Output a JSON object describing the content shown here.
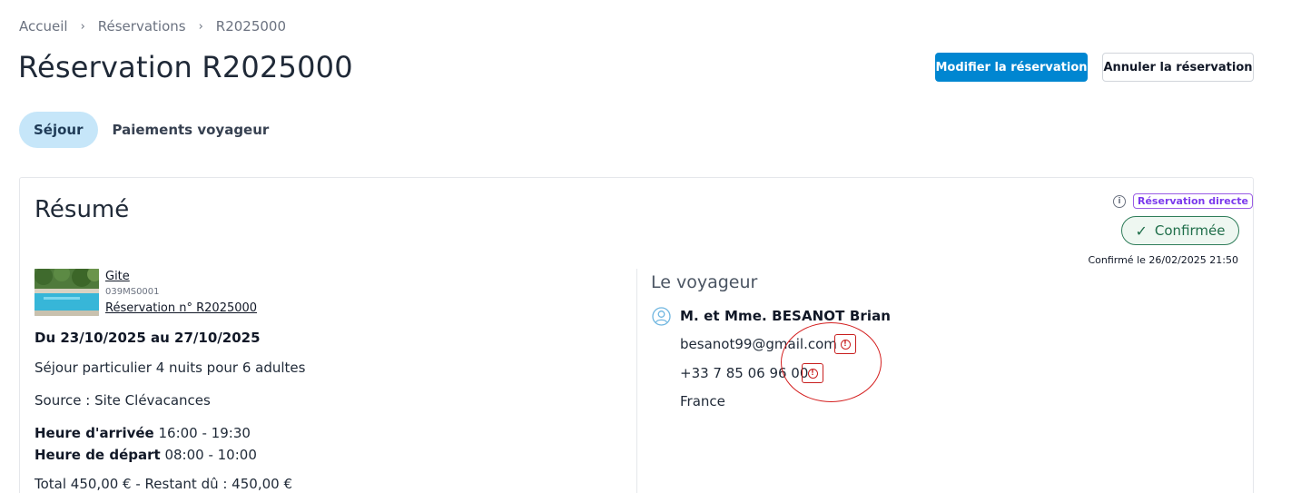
{
  "breadcrumb": {
    "home": "Accueil",
    "section": "Réservations",
    "current": "R2025000"
  },
  "page": {
    "title": "Réservation R2025000"
  },
  "actions": {
    "modify": "Modifier la réservation",
    "cancel": "Annuler la réservation"
  },
  "tabs": [
    {
      "label": "Séjour",
      "active": true
    },
    {
      "label": "Paiements voyageur",
      "active": false
    }
  ],
  "summary": {
    "title": "Résumé",
    "channel_badge": "Réservation directe",
    "status": "Confirmée",
    "status_icon": "check-icon",
    "confirmed_at": "Confirmé le 26/02/2025 21:50",
    "property": {
      "name": "Gite",
      "code": "039MS0001",
      "reservation_link": "Réservation n° R2025000"
    },
    "dates": "Du 23/10/2025 au 27/10/2025",
    "stay_description": "Séjour particulier 4 nuits pour 6 adultes",
    "source": "Source : Site Clévacances",
    "arrival_label": "Heure d'arrivée",
    "arrival_value": "16:00 - 19:30",
    "departure_label": "Heure de départ",
    "departure_value": "08:00 - 10:00",
    "total": "Total 450,00 €  -  Restant dû : 450,00 €"
  },
  "guest": {
    "section_title": "Le voyageur",
    "name": "M. et Mme.  BESANOT  Brian",
    "email": "besanot99@gmail.com",
    "phone": "+33 7 85 06 96 00",
    "country": "France"
  },
  "colors": {
    "primary": "#0086d1",
    "tab_active": "#c6e6f9",
    "confirmed": "#2f7d5a",
    "badge_direct": "#9b5de5",
    "warning": "#c81e1e"
  }
}
